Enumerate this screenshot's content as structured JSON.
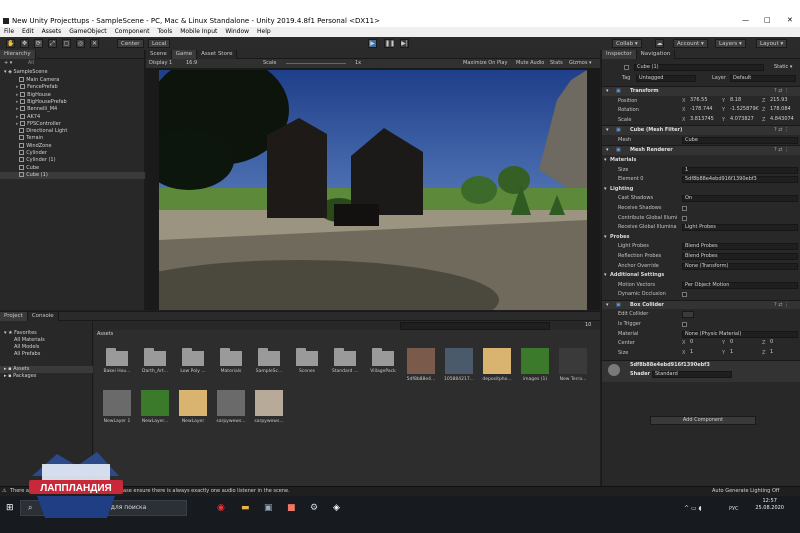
{
  "window": {
    "title": "New Unity Projecttups - SampleScene - PC, Mac & Linux Standalone - Unity 2019.4.8f1 Personal <DX11>",
    "min": "—",
    "max": "□",
    "close": "✕"
  },
  "menu": [
    "File",
    "Edit",
    "Assets",
    "GameObject",
    "Component",
    "Tools",
    "Mobile Input",
    "Window",
    "Help"
  ],
  "toolbar": {
    "pivot": "Center",
    "space": "Local",
    "collab": "Collab ▾",
    "account": "Account ▾",
    "layers": "Layers ▾",
    "layout": "Layout ▾"
  },
  "hierarchy": {
    "tab": "Hierarchy",
    "search": "All",
    "scene": "SampleScene",
    "items": [
      "Main Camera",
      "FencePrefab",
      "BigHouse",
      "BigHousePrefab",
      "Bennelli_M4",
      "AK74",
      "FPSController",
      "Directional Light",
      "Terrain",
      "WindZone",
      "Cylinder",
      "Cylinder (1)",
      "Cube",
      "Cube (1)"
    ]
  },
  "gameTabs": {
    "scene": "Scene",
    "game": "Game",
    "store": "Asset Store"
  },
  "gameBar": {
    "display": "Display 1",
    "aspect": "16:9",
    "scale": "Scale",
    "scaleVal": "1x",
    "max": "Maximize On Play",
    "mute": "Mute Audio",
    "stats": "Stats",
    "gizmos": "Gizmos ▾"
  },
  "project": {
    "tab": "Project",
    "console": "Console",
    "favorites": "Favorites",
    "fav": [
      "All Materials",
      "All Models",
      "All Prefabs"
    ],
    "assets": "Assets",
    "packages": "Packages",
    "count": "10",
    "breadcrumb": "Assets",
    "row1": [
      "Bakei Hou...",
      "Darth_Art...",
      "Low Poly ...",
      "Materials",
      "SampleSc...",
      "Scenes",
      "Standard ...",
      "VillagePack",
      "5df8b88e4...",
      "105884217...",
      "depositpho...",
      "images (1)",
      "New Terra..."
    ],
    "row2": [
      "NewLayer 1",
      "NewLayer...",
      "NewLayer",
      "sarpywews...",
      "sarpywews..."
    ]
  },
  "inspector": {
    "tab": "Inspector",
    "nav": "Navigation",
    "name": "Cube (1)",
    "static": "Static ▾",
    "tag": "Tag",
    "tagVal": "Untagged",
    "layer": "Layer",
    "layerVal": "Default",
    "transform": "Transform",
    "position": "Position",
    "rotation": "Rotation",
    "scale": "Scale",
    "pos": [
      "376.55",
      "8.18",
      "215.93"
    ],
    "rot": [
      "-178.744",
      "-1.525879€",
      "178.084"
    ],
    "scl": [
      "3.813745",
      "4.073827",
      "4.843074"
    ],
    "meshFilter": "Cube (Mesh Filter)",
    "mesh": "Mesh",
    "meshVal": "Cube",
    "meshRenderer": "Mesh Renderer",
    "materials": "Materials",
    "size": "Size",
    "sizeVal": "1",
    "element0": "Element 0",
    "element0Val": "5df8b88e4ebd916f1390ebf3",
    "lighting": "Lighting",
    "castShadows": "Cast Shadows",
    "castVal": "On",
    "receive": "Receive Shadows",
    "contribute": "Contribute Global Illumi",
    "receiveGI": "Receive Global Illumina",
    "receiveGIVal": "Light Probes",
    "probes": "Probes",
    "lightProbes": "Light Probes",
    "lightProbesVal": "Blend Probes",
    "reflProbes": "Reflection Probes",
    "reflVal": "Blend Probes",
    "anchor": "Anchor Override",
    "anchorVal": "None (Transform)",
    "additional": "Additional Settings",
    "motion": "Motion Vectors",
    "motionVal": "Per Object Motion",
    "dynocc": "Dynamic Occlusion",
    "boxCollider": "Box Collider",
    "editCollider": "Edit Collider",
    "isTrigger": "Is Trigger",
    "material": "Material",
    "materialVal": "None (Physic Material)",
    "center": "Center",
    "csize": "Size",
    "cen": [
      "0",
      "0",
      "0"
    ],
    "siz": [
      "1",
      "1",
      "1"
    ],
    "matName": "5df8b88e4ebd916f1390ebf3",
    "shader": "Shader",
    "shaderVal": "Standard",
    "addComponent": "Add Component"
  },
  "status": {
    "msg": "There are no audio listeners in the scene. Please ensure there is always exactly one audio listener in the scene.",
    "right": "Auto Generate Lighting Off"
  },
  "taskbar": {
    "search": "Введите здесь текст для поиска",
    "time": "12:57",
    "date": "25.08.2020",
    "lang": "РУС"
  },
  "logo": "ЛАППЛАНДИЯ",
  "colors": {
    "accent": "#3a6ea5",
    "panel": "#282828",
    "text": "#d2d2d2"
  }
}
